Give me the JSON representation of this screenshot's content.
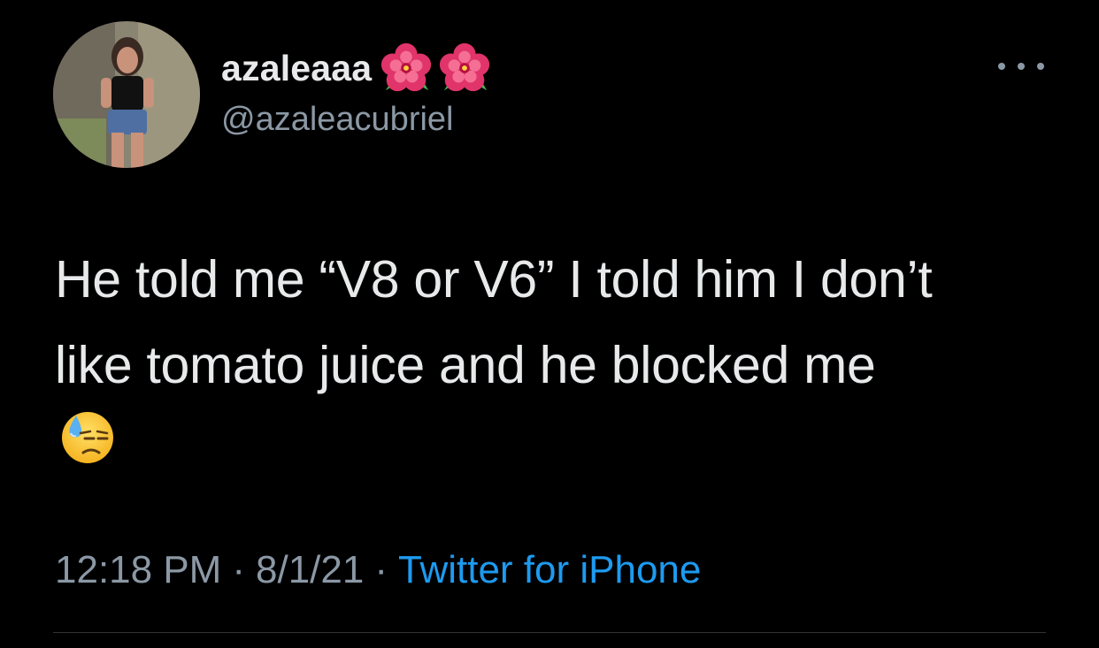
{
  "tweet": {
    "author": {
      "display_name": "azaleaaa",
      "name_emojis": [
        "hibiscus-icon",
        "hibiscus-icon"
      ],
      "handle": "@azaleacubriel",
      "avatar": "profile-photo"
    },
    "more_icon": "more-icon",
    "text_line_1": "He told me “V8 or V6” I told him I don’t",
    "text_line_2": "like tomato juice and he blocked me",
    "text_emoji": "downcast-face-with-sweat-icon",
    "meta": {
      "time": "12:18 PM",
      "separator": "·",
      "date": "8/1/21",
      "source": "Twitter for iPhone"
    }
  },
  "colors": {
    "background": "#000000",
    "primary_text": "#e7e9ea",
    "secondary_text": "#8b98a5",
    "link": "#1d9bf0",
    "divider": "#2f3336"
  }
}
